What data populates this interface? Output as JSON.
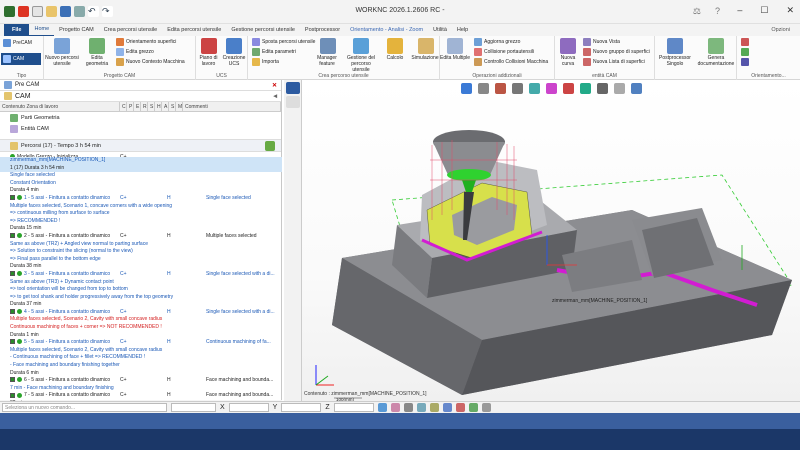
{
  "window": {
    "title": "WORKNC 2026.1.2606 RC -"
  },
  "tabs": [
    "File",
    "Home",
    "Progetto CAM",
    "Crea percorsi utensile",
    "Edita percorsi utensile",
    "Gestione percorsi utensile",
    "Postprocessor",
    "Orientamento - Analisi - Zoom",
    "Utilità",
    "Help"
  ],
  "opzioni": "Opzioni",
  "ribbon": {
    "tipo": {
      "label": "Tipo",
      "precam": "PreCAM",
      "cam": "CAM"
    },
    "progetto": {
      "label": "Progetto CAM",
      "nuovo": "Nuovo percorsi utensile",
      "edita": "Edita geometria",
      "orient": "Orientamento superfici",
      "grezzo": "Edita grezzo",
      "contesto": "Nuovo Contesto Macchina"
    },
    "ucs": {
      "label": "UCS",
      "piano": "Piano di lavoro",
      "creazione": "Creazione UCS"
    },
    "crea": {
      "label": "Crea percorso utensile",
      "sposta": "Sposta percorsi utensile",
      "param": "Edita parametri",
      "importa": "Importa",
      "manager": "Manager feature",
      "gestione": "Gestione del percorso utensile",
      "calcolo": "Calcolo",
      "simulazione": "Simulazione"
    },
    "operazioni": {
      "label": "Operazioni addizionali",
      "edita": "Edita Multiple",
      "aggiorna": "Aggiorna grezzo",
      "collisione": "Collisione portautensili",
      "controllo": "Controllo Collisioni Macchina"
    },
    "entita": {
      "label": "entità CAM",
      "nuova": "Nuova curva",
      "vista": "Nuova Vista",
      "gruppo": "Nuovo gruppo di superfici",
      "lista": "Nuova Lista di superfici"
    },
    "post": {
      "label": "",
      "pp": "Postprocessor Singolo",
      "genera": "Genera documentazione"
    },
    "orient": {
      "label": "Orientamento..."
    }
  },
  "left": {
    "precam": "Pre CAM",
    "cam": "CAM",
    "columns": [
      "Contenuto Zona di lavoro",
      "C",
      "P",
      "E",
      "R",
      "S",
      "H",
      "A",
      "S",
      "M",
      "Commenti"
    ],
    "parti": "Parti Geometria",
    "entita": "Entità CAM",
    "percorsi": "Percorsi (17) - Tempo 3 h 54 min",
    "modello": "Modello Grezzo - Inizializza",
    "modello_c": "C+"
  },
  "ops": [
    {
      "t": "zimmerman_mm[MACHINE_POSITION_1]",
      "cls": "blue sel"
    },
    {
      "t": "1 (17) Durata 3 h 54 min",
      "cls": "sel"
    },
    {
      "t": "Single face selected",
      "cls": "blue"
    },
    {
      "t": "Constant Orientation",
      "cls": "blue"
    },
    {
      "t": "Durata 4 min",
      "cls": ""
    },
    {
      "t": "1 - 5 assi - Finitura a contatto dinamico",
      "c": "C+",
      "h": "H",
      "cm": "Single face selected",
      "cls": "blue",
      "chk": true
    },
    {
      "t": "Multiple faces selected, Scenario 1, concave corners with a wide opening",
      "cls": "blue"
    },
    {
      "t": "=> continuous milling from surface to surface",
      "cls": "blue"
    },
    {
      "t": "=> RECOMMENDED !",
      "cls": "blue"
    },
    {
      "t": "Durata 15 min",
      "cls": ""
    },
    {
      "t": "2 - 5 assi - Finitura a contatto dinamico",
      "c": "C+",
      "h": "H",
      "cm": "Multiple faces selected",
      "cls": "",
      "chk": true
    },
    {
      "t": "Same as above (TR2) + Angled view normal to parting surface",
      "cls": "blue"
    },
    {
      "t": "=> Solution to constraint the slicing (normal to the view)",
      "cls": "blue"
    },
    {
      "t": "=> Final pass parallel to the bottom edge",
      "cls": "blue"
    },
    {
      "t": "Durata 38 min",
      "cls": ""
    },
    {
      "t": "3 - 5 assi - Finitura a contatto dinamico",
      "c": "C+",
      "h": "H",
      "cm": "Single face selected with a di...",
      "cls": "blue",
      "chk": true
    },
    {
      "t": "Same as above (TR3) + Dynamic contact point",
      "cls": "blue"
    },
    {
      "t": "=> tool orientation will be changed from top to bottom",
      "cls": "blue"
    },
    {
      "t": "=> to get tool shank and holder progressively away from the top geometry",
      "cls": "blue"
    },
    {
      "t": "Durata 37 min",
      "cls": ""
    },
    {
      "t": "4 - 5 assi - Finitura a contatto dinamico",
      "c": "C+",
      "h": "H",
      "cm": "Single face selected with a di...",
      "cls": "blue",
      "chk": true
    },
    {
      "t": "Multiple faces selected, Scenario 2, Cavity with small concave radius",
      "cls": "red"
    },
    {
      "t": "Continuous machining of faces + corner => NOT RECOMMENDED !",
      "cls": "red"
    },
    {
      "t": "Durata 1 min",
      "cls": ""
    },
    {
      "t": "5 - 5 assi - Finitura a contatto dinamico",
      "c": "C+",
      "h": "H",
      "cm": "Continuous machining of fa...",
      "cls": "blue",
      "chk": true
    },
    {
      "t": "Multiple faces selected, Scenario 2, Cavity with small concave radius",
      "cls": "blue"
    },
    {
      "t": "- Continuous machining of face + fillet => RECOMMENDED !",
      "cls": "blue"
    },
    {
      "t": "- Face machining and boundary finishing together",
      "cls": "blue"
    },
    {
      "t": "Durata 6 min",
      "cls": ""
    },
    {
      "t": "6 - 5 assi - Finitura a contatto dinamico",
      "c": "C+",
      "h": "H",
      "cm": "Face machining and bounda...",
      "cls": "",
      "chk": true
    },
    {
      "t": "7 min - Face machining and boundary finishing",
      "cls": "blue"
    },
    {
      "t": "7 - 5 assi - Finitura a contatto dinamico",
      "c": "C+",
      "h": "H",
      "cm": "Face machining and bounda...",
      "cls": "",
      "chk": true
    },
    {
      "t": "32 min",
      "cls": "hdr"
    },
    {
      "t": "8 - 5 assi - Finitura a contatto dinamico",
      "c": "C+",
      "h": "H",
      "cm": "Continuous machining of fa...",
      "cls": "red",
      "chk": true
    },
    {
      "t": "9 - 5 assi - Finitura a contatto dinamico",
      "c": "C+",
      "h": "H",
      "cm": "Continuous machining of fa...",
      "cls": "red",
      "chk": true
    }
  ],
  "view": {
    "contenuto": "Contenuto : zimmerman_mm[MACHINE_POSITION_1]",
    "scale": "100(mm)",
    "label3d": "zimmerman_mm[MACHINE_POSITION_1]"
  },
  "cmd": {
    "placeholder": "Seleziona un nuovo comando...",
    "x": "X",
    "y": "Y",
    "z": "Z"
  }
}
